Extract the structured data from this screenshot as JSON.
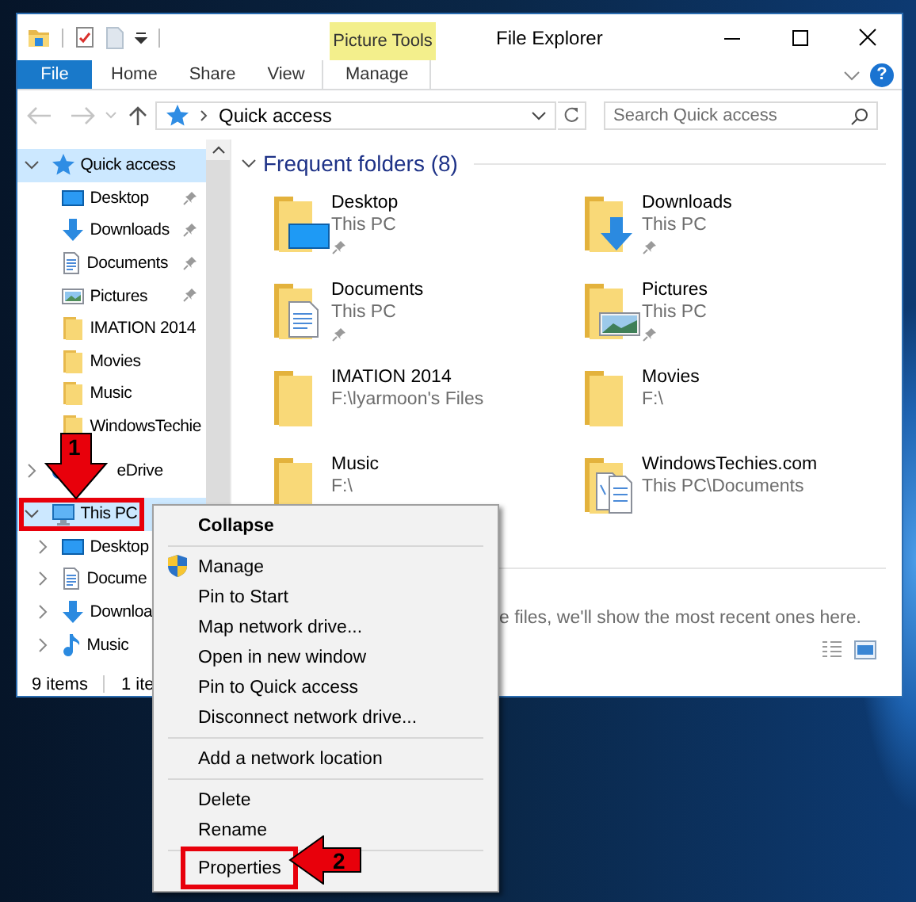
{
  "title_bar": {
    "tool_group": "Picture Tools",
    "title": "File Explorer"
  },
  "ribbon": {
    "tabs": [
      {
        "label": "File",
        "kind": "file",
        "selected": false
      },
      {
        "label": "Home",
        "kind": "tab",
        "selected": false
      },
      {
        "label": "Share",
        "kind": "tab",
        "selected": false
      },
      {
        "label": "View",
        "kind": "tab",
        "selected": false
      },
      {
        "label": "Manage",
        "kind": "contextual",
        "selected": false
      }
    ],
    "help": "?"
  },
  "address_bar": {
    "location": "Quick access",
    "search": {
      "placeholder": "Search Quick access"
    }
  },
  "navigation_pane": {
    "items": [
      {
        "label": "Quick access",
        "kind": "star",
        "expanded": true,
        "selected": true,
        "highlighted": false,
        "children": [
          {
            "label": "Desktop",
            "kind": "desktop",
            "pinned": true,
            "selected": false
          },
          {
            "label": "Downloads",
            "kind": "downloads",
            "pinned": true,
            "selected": false
          },
          {
            "label": "Documents",
            "kind": "documents",
            "pinned": true,
            "selected": false
          },
          {
            "label": "Pictures",
            "kind": "pictures",
            "pinned": true,
            "selected": false
          },
          {
            "label": "IMATION 2014",
            "kind": "folder",
            "pinned": false,
            "selected": false
          },
          {
            "label": "Movies",
            "kind": "folder",
            "pinned": false,
            "selected": false
          },
          {
            "label": "Music",
            "kind": "folder",
            "pinned": false,
            "selected": false
          },
          {
            "label": "WindowsTechie",
            "kind": "folder",
            "pinned": false,
            "selected": false
          }
        ]
      },
      {
        "label": "eDrive",
        "kind": "cloud",
        "expanded": false,
        "selected": false,
        "highlighted": false
      },
      {
        "label": "This PC",
        "kind": "pc",
        "expanded": true,
        "selected": true,
        "highlighted": true,
        "children": [
          {
            "label": "Desktop",
            "kind": "desktop",
            "expanded": false,
            "selected": false
          },
          {
            "label": "Docume",
            "kind": "documents",
            "expanded": false,
            "selected": false
          },
          {
            "label": "Downloa",
            "kind": "downloads",
            "expanded": false,
            "selected": false
          },
          {
            "label": "Music",
            "kind": "music",
            "expanded": false,
            "selected": false
          }
        ]
      }
    ]
  },
  "content": {
    "section": {
      "title": "Frequent folders (8)",
      "expanded": true
    },
    "folders": [
      {
        "name": "Desktop",
        "location": "This PC",
        "pinned": true,
        "kind": "desktop"
      },
      {
        "name": "Downloads",
        "location": "This PC",
        "pinned": true,
        "kind": "downloads"
      },
      {
        "name": "Documents",
        "location": "This PC",
        "pinned": true,
        "kind": "documents"
      },
      {
        "name": "Pictures",
        "location": "This PC",
        "pinned": true,
        "kind": "pictures"
      },
      {
        "name": "IMATION 2014",
        "location": "F:\\lyarmoon's Files",
        "pinned": false,
        "kind": "folder"
      },
      {
        "name": "Movies",
        "location": "F:\\",
        "pinned": false,
        "kind": "folder"
      },
      {
        "name": "Music",
        "location": "F:\\",
        "pinned": false,
        "kind": "folder"
      },
      {
        "name": "WindowsTechies.com",
        "location": "This PC\\Documents",
        "pinned": false,
        "kind": "web-documents"
      }
    ],
    "recent_note": "e files, we'll show the most recent ones here."
  },
  "status_bar": {
    "item_count": "9 items",
    "selection": "1 ite"
  },
  "context_menu": {
    "groups": [
      [
        {
          "label": "Collapse",
          "kind": "default",
          "highlighted": false
        }
      ],
      [
        {
          "label": "Manage",
          "kind": "admin",
          "highlighted": false
        },
        {
          "label": "Pin to Start",
          "kind": "command",
          "highlighted": false
        },
        {
          "label": "Map network drive...",
          "kind": "command",
          "highlighted": false
        },
        {
          "label": "Open in new window",
          "kind": "command",
          "highlighted": false
        },
        {
          "label": "Pin to Quick access",
          "kind": "command",
          "highlighted": false
        },
        {
          "label": "Disconnect network drive...",
          "kind": "command",
          "highlighted": false
        }
      ],
      [
        {
          "label": "Add a network location",
          "kind": "command",
          "highlighted": false
        }
      ],
      [
        {
          "label": "Delete",
          "kind": "command",
          "highlighted": false
        },
        {
          "label": "Rename",
          "kind": "command",
          "highlighted": false
        }
      ],
      [
        {
          "label": "Properties",
          "kind": "command",
          "highlighted": true
        }
      ]
    ]
  },
  "callouts": [
    {
      "number": "1"
    },
    {
      "number": "2"
    }
  ]
}
